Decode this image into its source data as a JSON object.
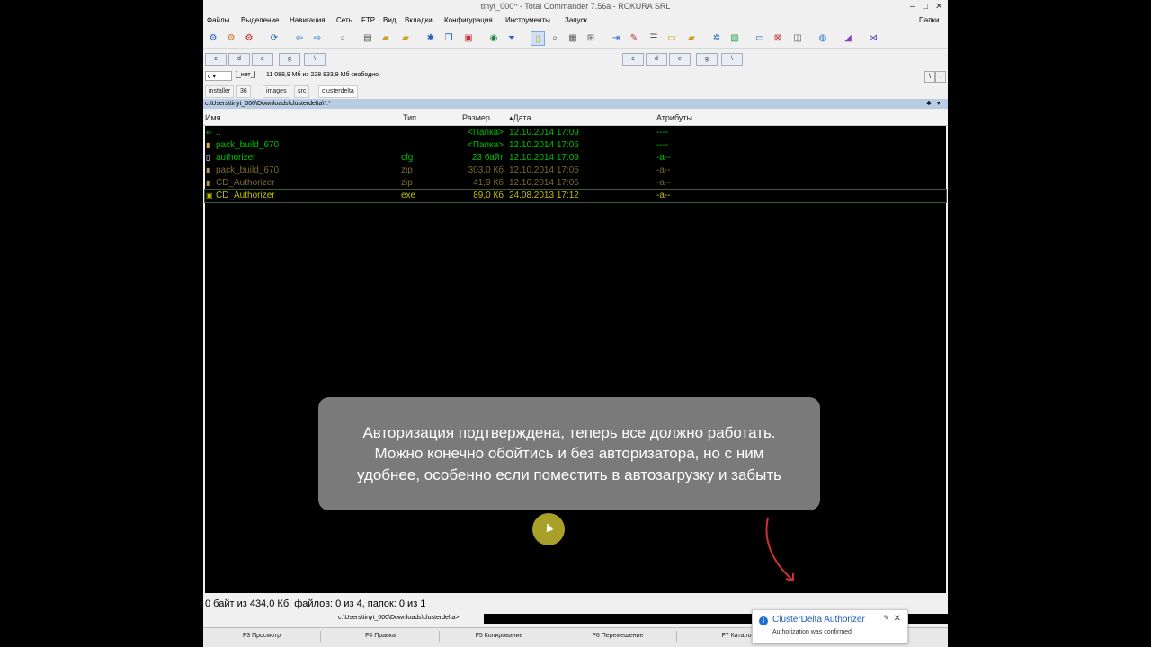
{
  "window": {
    "title": "tinyt_000^ - Total Commander 7.56a - ROKURA SRL"
  },
  "menu": {
    "items": [
      "Файлы",
      "Выделение",
      "Навигация",
      "Сеть",
      "FTP",
      "Вид",
      "Вкладки",
      "Конфигурация",
      "Инструменты",
      "Запуск"
    ],
    "right": "Папки"
  },
  "toolbar": {
    "icons": [
      "gear-icon",
      "gear-icon",
      "gear-icon",
      "refresh-icon",
      "back-icon",
      "forward-icon",
      "search-icon",
      "print-icon",
      "folder-icon",
      "folder-icon",
      "asterisk-icon",
      "copy-icon",
      "network-icon",
      "filter-icon",
      "page-icon",
      "search-icon",
      "archive-icon",
      "grid-icon",
      "export-icon",
      "edit-icon",
      "list-icon",
      "note-icon",
      "folder-icon",
      "settings-icon",
      "image-icon",
      "monitor-icon",
      "close-icon",
      "cube-icon",
      "sphere-icon",
      "paint-icon",
      "vs-icon"
    ]
  },
  "drives": {
    "left": [
      "c",
      "d",
      "e",
      "g",
      "\\"
    ],
    "right": [
      "c",
      "d",
      "e",
      "g",
      "\\"
    ]
  },
  "info": {
    "drive_select": "c",
    "volume": "[_нет_]",
    "free_space": "11 088,9 Мб из 228 833,9 Мб свободно",
    "right_btns": [
      "\\",
      "."
    ]
  },
  "tabs": [
    {
      "label": "installer",
      "active": false
    },
    {
      "label": "36",
      "active": false
    },
    {
      "label": "images",
      "active": false
    },
    {
      "label": "src",
      "active": false
    },
    {
      "label": "clusterdelta",
      "active": true
    }
  ],
  "path": "c:\\Users\\tinyt_000\\Downloads\\clusterdelta\\*.*",
  "columns": {
    "name": "Имя",
    "type": "Тип",
    "size": "Размер",
    "date": "Дата",
    "attrs": "Атрибуты"
  },
  "files": [
    {
      "icon": "up-arrow-icon",
      "name": "..",
      "type": "",
      "size": "<Папка>",
      "date": "12.10.2014 17:09",
      "attrs": "----",
      "color": "#00c000",
      "selected": false
    },
    {
      "icon": "folder-icon",
      "name": "pack_build_670",
      "type": "",
      "size": "<Папка>",
      "date": "12.10.2014 17:05",
      "attrs": "----",
      "color": "#00c000",
      "selected": false
    },
    {
      "icon": "file-icon",
      "name": "authorizer",
      "type": "cfg",
      "size": "23 байт",
      "date": "12.10.2014 17:09",
      "attrs": "-a--",
      "color": "#00c000",
      "selected": false
    },
    {
      "icon": "zip-icon",
      "name": "pack_build_670",
      "type": "zip",
      "size": "303,0 Кб",
      "date": "12.10.2014 17:05",
      "attrs": "-a--",
      "color": "#7a6a2a",
      "selected": false
    },
    {
      "icon": "zip-icon",
      "name": "CD_Authorizer",
      "type": "zip",
      "size": "41,9 Кб",
      "date": "12.10.2014 17:05",
      "attrs": "-a--",
      "color": "#7a6a2a",
      "selected": false
    },
    {
      "icon": "exe-icon",
      "name": "CD_Authorizer",
      "type": "exe",
      "size": "89,0 Кб",
      "date": "24.08.2013 17:12",
      "attrs": "-a--",
      "color": "#c0c000",
      "selected": true
    }
  ],
  "status": "0 байт из 434,0 Кб, файлов: 0 из 4, папок: 0 из 1",
  "cmdline": {
    "prompt": "c:\\Users\\tinyt_000\\Downloads\\clusterdelta>"
  },
  "fkeys": [
    "F3 Просмотр",
    "F4 Правка",
    "F5 Копирование",
    "F6 Перемещение",
    "F7 Катало"
  ],
  "caption": {
    "text": "Авторизация подтверждена, теперь все должно работать. Можно конечно обойтись и без авторизатора, но с ним удобнее, особенно если поместить в автозагрузку и забыть"
  },
  "notification": {
    "title": "ClusterDelta Authorizer",
    "message": "Authorization was confirmed"
  },
  "colors": {
    "highlight": "#a9a02a",
    "path_bar": "#b8cce4",
    "arrow": "#d03030"
  }
}
